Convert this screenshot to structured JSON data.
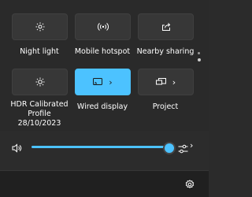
{
  "tiles": [
    {
      "label": "Night light",
      "icon": "brightness-icon",
      "active": false
    },
    {
      "label": "Mobile hotspot",
      "icon": "hotspot-icon",
      "active": false
    },
    {
      "label": "Nearby sharing",
      "icon": "share-icon",
      "active": false
    },
    {
      "label": "HDR Calibrated Profile 28/10/2023",
      "icon": "hdr-brightness-icon",
      "active": false
    },
    {
      "label": "Wired display",
      "icon": "cast-icon",
      "active": true,
      "chevron": "›"
    },
    {
      "label": "Project",
      "icon": "project-icon",
      "active": false,
      "chevron": "›"
    }
  ],
  "volume": {
    "level": 1.0,
    "icon": "speaker-icon",
    "output_icon": "audio-output-icon",
    "chevron": "›"
  },
  "footer": {
    "settings_icon": "gear-icon"
  },
  "colors": {
    "accent": "#4cc2ff",
    "tile": "#373737",
    "background": "#2c2c2c"
  }
}
